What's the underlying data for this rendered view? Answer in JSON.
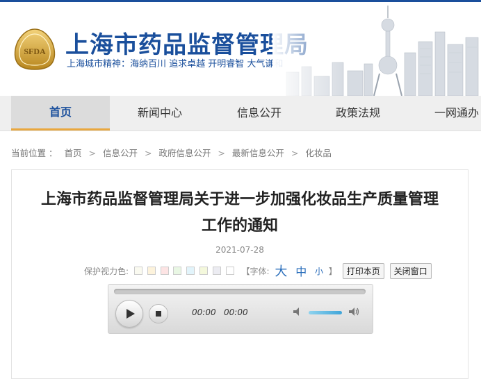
{
  "header": {
    "title": "上海市药品监督管理局",
    "slogan": "上海城市精神：海纳百川  追求卓越  开明睿智  大气谦和",
    "logo_text": "SFDA",
    "brand_color": "#1a4f9c",
    "accent_color": "#e9a73e"
  },
  "nav": {
    "items": [
      {
        "label": "首页",
        "active": true
      },
      {
        "label": "新闻中心",
        "active": false
      },
      {
        "label": "信息公开",
        "active": false
      },
      {
        "label": "政策法规",
        "active": false
      },
      {
        "label": "一网通办",
        "active": false
      }
    ]
  },
  "breadcrumb": {
    "prefix": "当前位置 ：",
    "separator": ">",
    "items": [
      "首页",
      "信息公开",
      "政府信息公开",
      "最新信息公开",
      "化妆品"
    ]
  },
  "article": {
    "title_line1": "上海市药品监督管理局关于进一步加强化妆品生产质量管理",
    "title_line2": "工作的通知",
    "date": "2021-07-28"
  },
  "tools": {
    "eye_care_label": "保护视力色:",
    "swatch_colors": [
      "#fafaf0",
      "#fdf3dc",
      "#fde4e4",
      "#e9f7e4",
      "#e2f4fb",
      "#f4f8dc",
      "#ececf2",
      "#ffffff"
    ],
    "font_label_open": "【字体:",
    "font_large": "大",
    "font_medium": "中",
    "font_small": "小",
    "font_label_close": "】",
    "print_button": "打印本页",
    "close_button": "关闭窗口"
  },
  "player": {
    "current_time": "00:00",
    "duration": "00:00",
    "progress": 0,
    "volume": 0.8,
    "icons": [
      "play-icon",
      "stop-icon",
      "volume-mute-icon",
      "volume-max-icon"
    ]
  }
}
